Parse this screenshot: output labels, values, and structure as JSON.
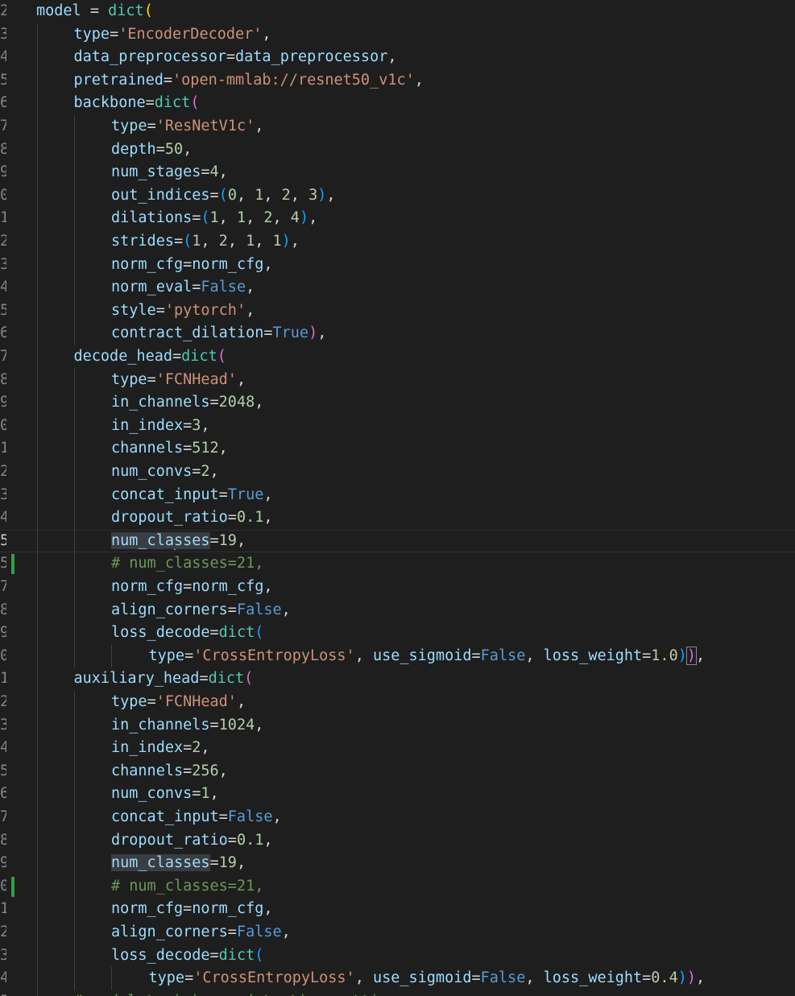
{
  "editor": {
    "lines": [
      {
        "ln": "2",
        "indent": 0,
        "tokens": [
          [
            "model",
            "var"
          ],
          [
            " = ",
            "op"
          ],
          [
            "dict",
            "fn"
          ],
          [
            "(",
            "b1"
          ]
        ]
      },
      {
        "ln": "3",
        "indent": 1,
        "tokens": [
          [
            "type",
            "var"
          ],
          [
            "=",
            "op"
          ],
          [
            "'EncoderDecoder'",
            "str"
          ],
          [
            ",",
            "op"
          ]
        ]
      },
      {
        "ln": "4",
        "indent": 1,
        "tokens": [
          [
            "data_preprocessor",
            "var"
          ],
          [
            "=",
            "op"
          ],
          [
            "data_preprocessor",
            "var"
          ],
          [
            ",",
            "op"
          ]
        ]
      },
      {
        "ln": "5",
        "indent": 1,
        "tokens": [
          [
            "pretrained",
            "var"
          ],
          [
            "=",
            "op"
          ],
          [
            "'open-mmlab://resnet50_v1c'",
            "str"
          ],
          [
            ",",
            "op"
          ]
        ]
      },
      {
        "ln": "6",
        "indent": 1,
        "tokens": [
          [
            "backbone",
            "var"
          ],
          [
            "=",
            "op"
          ],
          [
            "dict",
            "fn"
          ],
          [
            "(",
            "b2"
          ]
        ]
      },
      {
        "ln": "7",
        "indent": 2,
        "tokens": [
          [
            "type",
            "var"
          ],
          [
            "=",
            "op"
          ],
          [
            "'ResNetV1c'",
            "str"
          ],
          [
            ",",
            "op"
          ]
        ]
      },
      {
        "ln": "8",
        "indent": 2,
        "tokens": [
          [
            "depth",
            "var"
          ],
          [
            "=",
            "op"
          ],
          [
            "50",
            "num"
          ],
          [
            ",",
            "op"
          ]
        ]
      },
      {
        "ln": "9",
        "indent": 2,
        "tokens": [
          [
            "num_stages",
            "var"
          ],
          [
            "=",
            "op"
          ],
          [
            "4",
            "num"
          ],
          [
            ",",
            "op"
          ]
        ]
      },
      {
        "ln": "0",
        "indent": 2,
        "tokens": [
          [
            "out_indices",
            "var"
          ],
          [
            "=",
            "op"
          ],
          [
            "(",
            "b3"
          ],
          [
            "0",
            "num"
          ],
          [
            ", ",
            "op"
          ],
          [
            "1",
            "num"
          ],
          [
            ", ",
            "op"
          ],
          [
            "2",
            "num"
          ],
          [
            ", ",
            "op"
          ],
          [
            "3",
            "num"
          ],
          [
            ")",
            "b3"
          ],
          [
            ",",
            "op"
          ]
        ]
      },
      {
        "ln": "1",
        "indent": 2,
        "tokens": [
          [
            "dilations",
            "var"
          ],
          [
            "=",
            "op"
          ],
          [
            "(",
            "b3"
          ],
          [
            "1",
            "num"
          ],
          [
            ", ",
            "op"
          ],
          [
            "1",
            "num"
          ],
          [
            ", ",
            "op"
          ],
          [
            "2",
            "num"
          ],
          [
            ", ",
            "op"
          ],
          [
            "4",
            "num"
          ],
          [
            ")",
            "b3"
          ],
          [
            ",",
            "op"
          ]
        ]
      },
      {
        "ln": "2",
        "indent": 2,
        "tokens": [
          [
            "strides",
            "var"
          ],
          [
            "=",
            "op"
          ],
          [
            "(",
            "b3"
          ],
          [
            "1",
            "num"
          ],
          [
            ", ",
            "op"
          ],
          [
            "2",
            "num"
          ],
          [
            ", ",
            "op"
          ],
          [
            "1",
            "num"
          ],
          [
            ", ",
            "op"
          ],
          [
            "1",
            "num"
          ],
          [
            ")",
            "b3"
          ],
          [
            ",",
            "op"
          ]
        ]
      },
      {
        "ln": "3",
        "indent": 2,
        "tokens": [
          [
            "norm_cfg",
            "var"
          ],
          [
            "=",
            "op"
          ],
          [
            "norm_cfg",
            "var"
          ],
          [
            ",",
            "op"
          ]
        ]
      },
      {
        "ln": "4",
        "indent": 2,
        "tokens": [
          [
            "norm_eval",
            "var"
          ],
          [
            "=",
            "op"
          ],
          [
            "False",
            "kw"
          ],
          [
            ",",
            "op"
          ]
        ]
      },
      {
        "ln": "5",
        "indent": 2,
        "tokens": [
          [
            "style",
            "var"
          ],
          [
            "=",
            "op"
          ],
          [
            "'pytorch'",
            "str"
          ],
          [
            ",",
            "op"
          ]
        ]
      },
      {
        "ln": "6",
        "indent": 2,
        "tokens": [
          [
            "contract_dilation",
            "var"
          ],
          [
            "=",
            "op"
          ],
          [
            "True",
            "kw"
          ],
          [
            ")",
            "b2"
          ],
          [
            ",",
            "op"
          ]
        ]
      },
      {
        "ln": "7",
        "indent": 1,
        "tokens": [
          [
            "decode_head",
            "var"
          ],
          [
            "=",
            "op"
          ],
          [
            "dict",
            "fn"
          ],
          [
            "(",
            "b2"
          ]
        ]
      },
      {
        "ln": "8",
        "indent": 2,
        "tokens": [
          [
            "type",
            "var"
          ],
          [
            "=",
            "op"
          ],
          [
            "'FCNHead'",
            "str"
          ],
          [
            ",",
            "op"
          ]
        ]
      },
      {
        "ln": "9",
        "indent": 2,
        "tokens": [
          [
            "in_channels",
            "var"
          ],
          [
            "=",
            "op"
          ],
          [
            "2048",
            "num"
          ],
          [
            ",",
            "op"
          ]
        ]
      },
      {
        "ln": "0",
        "indent": 2,
        "tokens": [
          [
            "in_index",
            "var"
          ],
          [
            "=",
            "op"
          ],
          [
            "3",
            "num"
          ],
          [
            ",",
            "op"
          ]
        ]
      },
      {
        "ln": "1",
        "indent": 2,
        "tokens": [
          [
            "channels",
            "var"
          ],
          [
            "=",
            "op"
          ],
          [
            "512",
            "num"
          ],
          [
            ",",
            "op"
          ]
        ]
      },
      {
        "ln": "2",
        "indent": 2,
        "tokens": [
          [
            "num_convs",
            "var"
          ],
          [
            "=",
            "op"
          ],
          [
            "2",
            "num"
          ],
          [
            ",",
            "op"
          ]
        ]
      },
      {
        "ln": "3",
        "indent": 2,
        "tokens": [
          [
            "concat_input",
            "var"
          ],
          [
            "=",
            "op"
          ],
          [
            "True",
            "kw"
          ],
          [
            ",",
            "op"
          ]
        ]
      },
      {
        "ln": "4",
        "indent": 2,
        "tokens": [
          [
            "dropout_ratio",
            "var"
          ],
          [
            "=",
            "op"
          ],
          [
            "0.1",
            "num"
          ],
          [
            ",",
            "op"
          ]
        ]
      },
      {
        "ln": "5",
        "indent": 2,
        "current": true,
        "tokens": [
          [
            "num_cla",
            "var",
            "hl"
          ],
          [
            "|",
            "cursor"
          ],
          [
            "sses",
            "var",
            "hl"
          ],
          [
            "=",
            "op"
          ],
          [
            "19",
            "num"
          ],
          [
            ",",
            "op"
          ]
        ]
      },
      {
        "ln": "5",
        "indent": 2,
        "mark": true,
        "tokens": [
          [
            "# num_classes=21,",
            "com"
          ]
        ]
      },
      {
        "ln": "7",
        "indent": 2,
        "tokens": [
          [
            "norm_cfg",
            "var"
          ],
          [
            "=",
            "op"
          ],
          [
            "norm_cfg",
            "var"
          ],
          [
            ",",
            "op"
          ]
        ]
      },
      {
        "ln": "8",
        "indent": 2,
        "tokens": [
          [
            "align_corners",
            "var"
          ],
          [
            "=",
            "op"
          ],
          [
            "False",
            "kw"
          ],
          [
            ",",
            "op"
          ]
        ]
      },
      {
        "ln": "9",
        "indent": 2,
        "tokens": [
          [
            "loss_decode",
            "var"
          ],
          [
            "=",
            "op"
          ],
          [
            "dict",
            "fn"
          ],
          [
            "(",
            "b3"
          ]
        ]
      },
      {
        "ln": "0",
        "indent": 3,
        "tokens": [
          [
            "type",
            "var"
          ],
          [
            "=",
            "op"
          ],
          [
            "'CrossEntropyLoss'",
            "str"
          ],
          [
            ", ",
            "op"
          ],
          [
            "use_sigmoid",
            "var"
          ],
          [
            "=",
            "op"
          ],
          [
            "False",
            "kw"
          ],
          [
            ", ",
            "op"
          ],
          [
            "loss_weight",
            "var"
          ],
          [
            "=",
            "op"
          ],
          [
            "1.0",
            "num"
          ],
          [
            ")",
            "b3"
          ],
          [
            ")",
            "b2",
            "match"
          ],
          [
            ",",
            "op"
          ]
        ]
      },
      {
        "ln": "1",
        "indent": 1,
        "tokens": [
          [
            "auxiliary_head",
            "var"
          ],
          [
            "=",
            "op"
          ],
          [
            "dict",
            "fn"
          ],
          [
            "(",
            "b2"
          ]
        ]
      },
      {
        "ln": "2",
        "indent": 2,
        "tokens": [
          [
            "type",
            "var"
          ],
          [
            "=",
            "op"
          ],
          [
            "'FCNHead'",
            "str"
          ],
          [
            ",",
            "op"
          ]
        ]
      },
      {
        "ln": "3",
        "indent": 2,
        "tokens": [
          [
            "in_channels",
            "var"
          ],
          [
            "=",
            "op"
          ],
          [
            "1024",
            "num"
          ],
          [
            ",",
            "op"
          ]
        ]
      },
      {
        "ln": "4",
        "indent": 2,
        "tokens": [
          [
            "in_index",
            "var"
          ],
          [
            "=",
            "op"
          ],
          [
            "2",
            "num"
          ],
          [
            ",",
            "op"
          ]
        ]
      },
      {
        "ln": "5",
        "indent": 2,
        "tokens": [
          [
            "channels",
            "var"
          ],
          [
            "=",
            "op"
          ],
          [
            "256",
            "num"
          ],
          [
            ",",
            "op"
          ]
        ]
      },
      {
        "ln": "6",
        "indent": 2,
        "tokens": [
          [
            "num_convs",
            "var"
          ],
          [
            "=",
            "op"
          ],
          [
            "1",
            "num"
          ],
          [
            ",",
            "op"
          ]
        ]
      },
      {
        "ln": "7",
        "indent": 2,
        "tokens": [
          [
            "concat_input",
            "var"
          ],
          [
            "=",
            "op"
          ],
          [
            "False",
            "kw"
          ],
          [
            ",",
            "op"
          ]
        ]
      },
      {
        "ln": "8",
        "indent": 2,
        "tokens": [
          [
            "dropout_ratio",
            "var"
          ],
          [
            "=",
            "op"
          ],
          [
            "0.1",
            "num"
          ],
          [
            ",",
            "op"
          ]
        ]
      },
      {
        "ln": "9",
        "indent": 2,
        "tokens": [
          [
            "num_classes",
            "var",
            "hl"
          ],
          [
            "=",
            "op"
          ],
          [
            "19",
            "num"
          ],
          [
            ",",
            "op"
          ]
        ]
      },
      {
        "ln": "0",
        "indent": 2,
        "mark": true,
        "tokens": [
          [
            "# num_classes=21,",
            "com"
          ]
        ]
      },
      {
        "ln": "1",
        "indent": 2,
        "tokens": [
          [
            "norm_cfg",
            "var"
          ],
          [
            "=",
            "op"
          ],
          [
            "norm_cfg",
            "var"
          ],
          [
            ",",
            "op"
          ]
        ]
      },
      {
        "ln": "2",
        "indent": 2,
        "tokens": [
          [
            "align_corners",
            "var"
          ],
          [
            "=",
            "op"
          ],
          [
            "False",
            "kw"
          ],
          [
            ",",
            "op"
          ]
        ]
      },
      {
        "ln": "3",
        "indent": 2,
        "tokens": [
          [
            "loss_decode",
            "var"
          ],
          [
            "=",
            "op"
          ],
          [
            "dict",
            "fn"
          ],
          [
            "(",
            "b3"
          ]
        ]
      },
      {
        "ln": "4",
        "indent": 3,
        "tokens": [
          [
            "type",
            "var"
          ],
          [
            "=",
            "op"
          ],
          [
            "'CrossEntropyLoss'",
            "str"
          ],
          [
            ", ",
            "op"
          ],
          [
            "use_sigmoid",
            "var"
          ],
          [
            "=",
            "op"
          ],
          [
            "False",
            "kw"
          ],
          [
            ", ",
            "op"
          ],
          [
            "loss_weight",
            "var"
          ],
          [
            "=",
            "op"
          ],
          [
            "0.4",
            "num"
          ],
          [
            ")",
            "b3"
          ],
          [
            ")",
            "b2"
          ],
          [
            ",",
            "op"
          ]
        ]
      },
      {
        "ln": "5",
        "indent": 1,
        "tokens": [
          [
            "# model training and testing settings",
            "com"
          ]
        ]
      }
    ]
  }
}
